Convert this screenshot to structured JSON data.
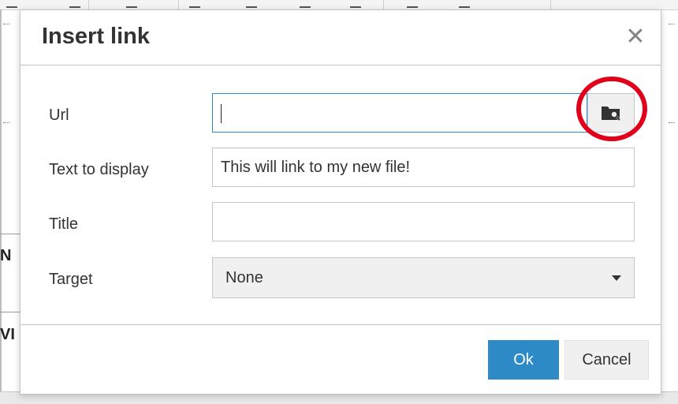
{
  "background": {
    "visible_letters": [
      "N",
      "VI"
    ]
  },
  "dialog": {
    "title": "Insert link",
    "close_glyph": "✕",
    "fields": {
      "url": {
        "label": "Url",
        "value": ""
      },
      "text_to_display": {
        "label": "Text to display",
        "value": "This will link to my new file!"
      },
      "title": {
        "label": "Title",
        "value": ""
      },
      "target": {
        "label": "Target",
        "selected": "None"
      }
    },
    "browse_icon": "folder-search-icon",
    "buttons": {
      "ok": "Ok",
      "cancel": "Cancel"
    }
  },
  "colors": {
    "accent": "#2d8ac7",
    "highlight_circle": "#e1001a"
  }
}
